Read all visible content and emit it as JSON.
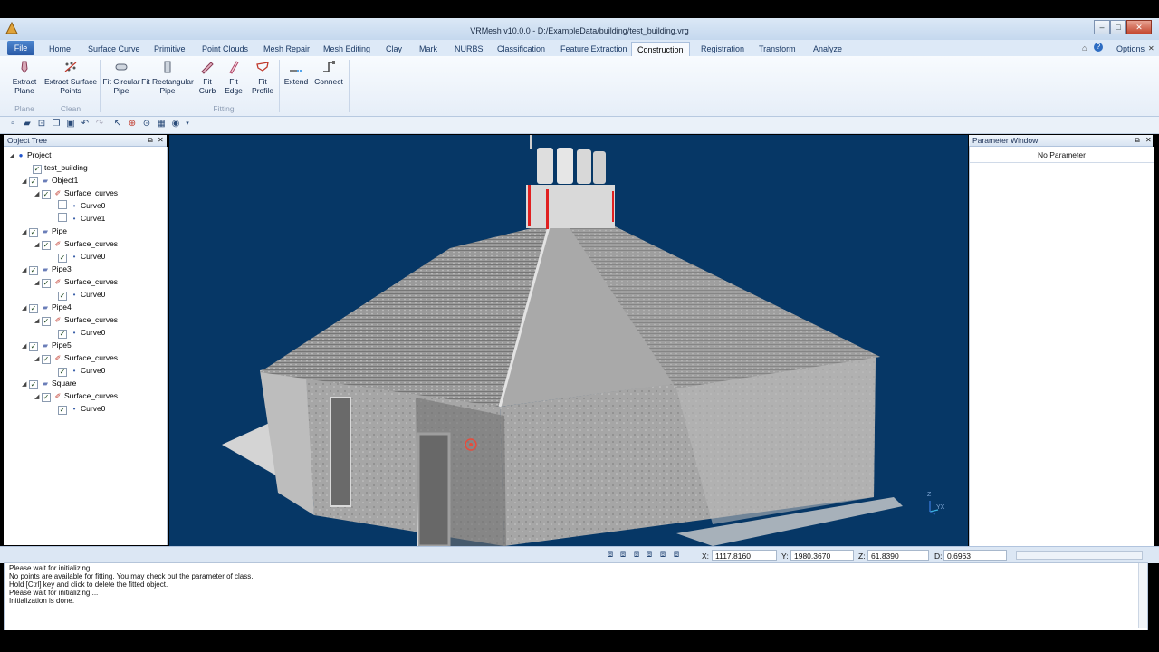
{
  "window": {
    "title": "VRMesh v10.0.0 - D:/ExampleData/building/test_building.vrg"
  },
  "menu": {
    "file": "File",
    "tabs": [
      "Home",
      "Surface Curve",
      "Primitive",
      "Point Clouds",
      "Mesh Repair",
      "Mesh Editing",
      "Clay",
      "Mark",
      "NURBS",
      "Classification",
      "Feature Extraction",
      "Construction",
      "Registration",
      "Transform",
      "Analyze"
    ],
    "active_tab": "Construction",
    "options": "Options"
  },
  "ribbon": {
    "buttons": [
      {
        "label1": "Extract",
        "label2": "Plane"
      },
      {
        "label1": "Extract Surface",
        "label2": "Points"
      },
      {
        "label1": "Fit Circular",
        "label2": "Pipe"
      },
      {
        "label1": "Fit Rectangular",
        "label2": "Pipe"
      },
      {
        "label1": "Fit",
        "label2": "Curb"
      },
      {
        "label1": "Fit",
        "label2": "Edge"
      },
      {
        "label1": "Fit",
        "label2": "Profile"
      },
      {
        "label1": "Extend",
        "label2": ""
      },
      {
        "label1": "Connect",
        "label2": ""
      }
    ],
    "groups": [
      "Plane",
      "Clean",
      "Fitting"
    ]
  },
  "object_tree": {
    "title": "Object Tree",
    "rows": [
      {
        "label": "Project"
      },
      {
        "label": "test_building"
      },
      {
        "label": "Object1"
      },
      {
        "label": "Surface_curves"
      },
      {
        "label": "Curve0"
      },
      {
        "label": "Curve1"
      },
      {
        "label": "Pipe"
      },
      {
        "label": "Surface_curves"
      },
      {
        "label": "Curve0"
      },
      {
        "label": "Pipe3"
      },
      {
        "label": "Surface_curves"
      },
      {
        "label": "Curve0"
      },
      {
        "label": "Pipe4"
      },
      {
        "label": "Surface_curves"
      },
      {
        "label": "Curve0"
      },
      {
        "label": "Pipe5"
      },
      {
        "label": "Surface_curves"
      },
      {
        "label": "Curve0"
      },
      {
        "label": "Square"
      },
      {
        "label": "Surface_curves"
      },
      {
        "label": "Curve0"
      }
    ]
  },
  "parameter_window": {
    "title": "Parameter Window",
    "content": "No Parameter"
  },
  "viewport": {
    "axis_z": "Z",
    "axis_yx": "YX"
  },
  "status": {
    "x_label": "X:",
    "x_value": "1117.8160",
    "y_label": "Y:",
    "y_value": "1980.3670",
    "z_label": "Z:",
    "z_value": "61.8390",
    "d_label": "D:",
    "d_value": "0.6963"
  },
  "log": [
    "Please wait for initializing ...",
    "No points are available for fitting. You may check out the parameter of class.",
    "Hold [Ctrl] key and click to delete the fitted object.",
    "Please wait for initializing ...",
    "Initialization is done."
  ],
  "colors": {
    "viewport_bg": "#063766",
    "accent": "#2a5aa6"
  }
}
